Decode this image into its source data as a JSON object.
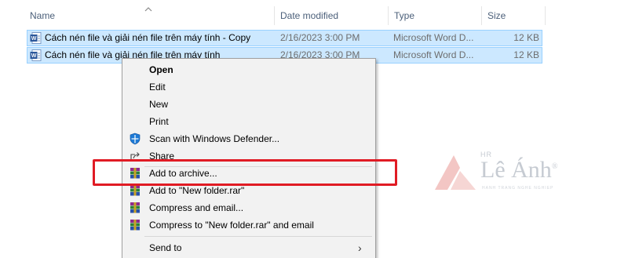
{
  "columns": {
    "name": "Name",
    "date": "Date modified",
    "type": "Type",
    "size": "Size"
  },
  "files": [
    {
      "name": "Cách nén file và giải nén file trên máy tính - Copy",
      "date": "2/16/2023 3:00 PM",
      "type": "Microsoft Word D...",
      "size": "12 KB",
      "icon": "word-doc-icon"
    },
    {
      "name": "Cách nén file và giải nén file trên máy tính",
      "date": "2/16/2023 3:00 PM",
      "type": "Microsoft Word D...",
      "size": "12 KB",
      "icon": "word-doc-icon"
    }
  ],
  "context_menu": {
    "items": [
      {
        "label": "Open",
        "bold": true
      },
      {
        "label": "Edit"
      },
      {
        "label": "New"
      },
      {
        "label": "Print"
      },
      {
        "label": "Scan with Windows Defender...",
        "icon": "windows-defender-icon"
      },
      {
        "label": "Share",
        "icon": "share-icon"
      },
      {
        "label": "Add to archive...",
        "icon": "winrar-icon",
        "highlighted": true
      },
      {
        "label": "Add to \"New folder.rar\"",
        "icon": "winrar-icon"
      },
      {
        "label": "Compress and email...",
        "icon": "winrar-icon"
      },
      {
        "label": "Compress to \"New folder.rar\" and email",
        "icon": "winrar-icon"
      },
      {
        "label": "Send to",
        "submenu": true
      }
    ],
    "submenu_glyph": "›"
  },
  "watermark": {
    "prefix": "HR",
    "name": "Lê Ánh",
    "registered": "®",
    "tagline": "HANH TRANG NGHE NGHIEP"
  },
  "colors": {
    "selection_bg": "#cce8ff",
    "selection_border": "#99d1ff",
    "highlight_box": "#e01b24",
    "header_text": "#4c607a",
    "logo_red": "#f3c6c4"
  }
}
